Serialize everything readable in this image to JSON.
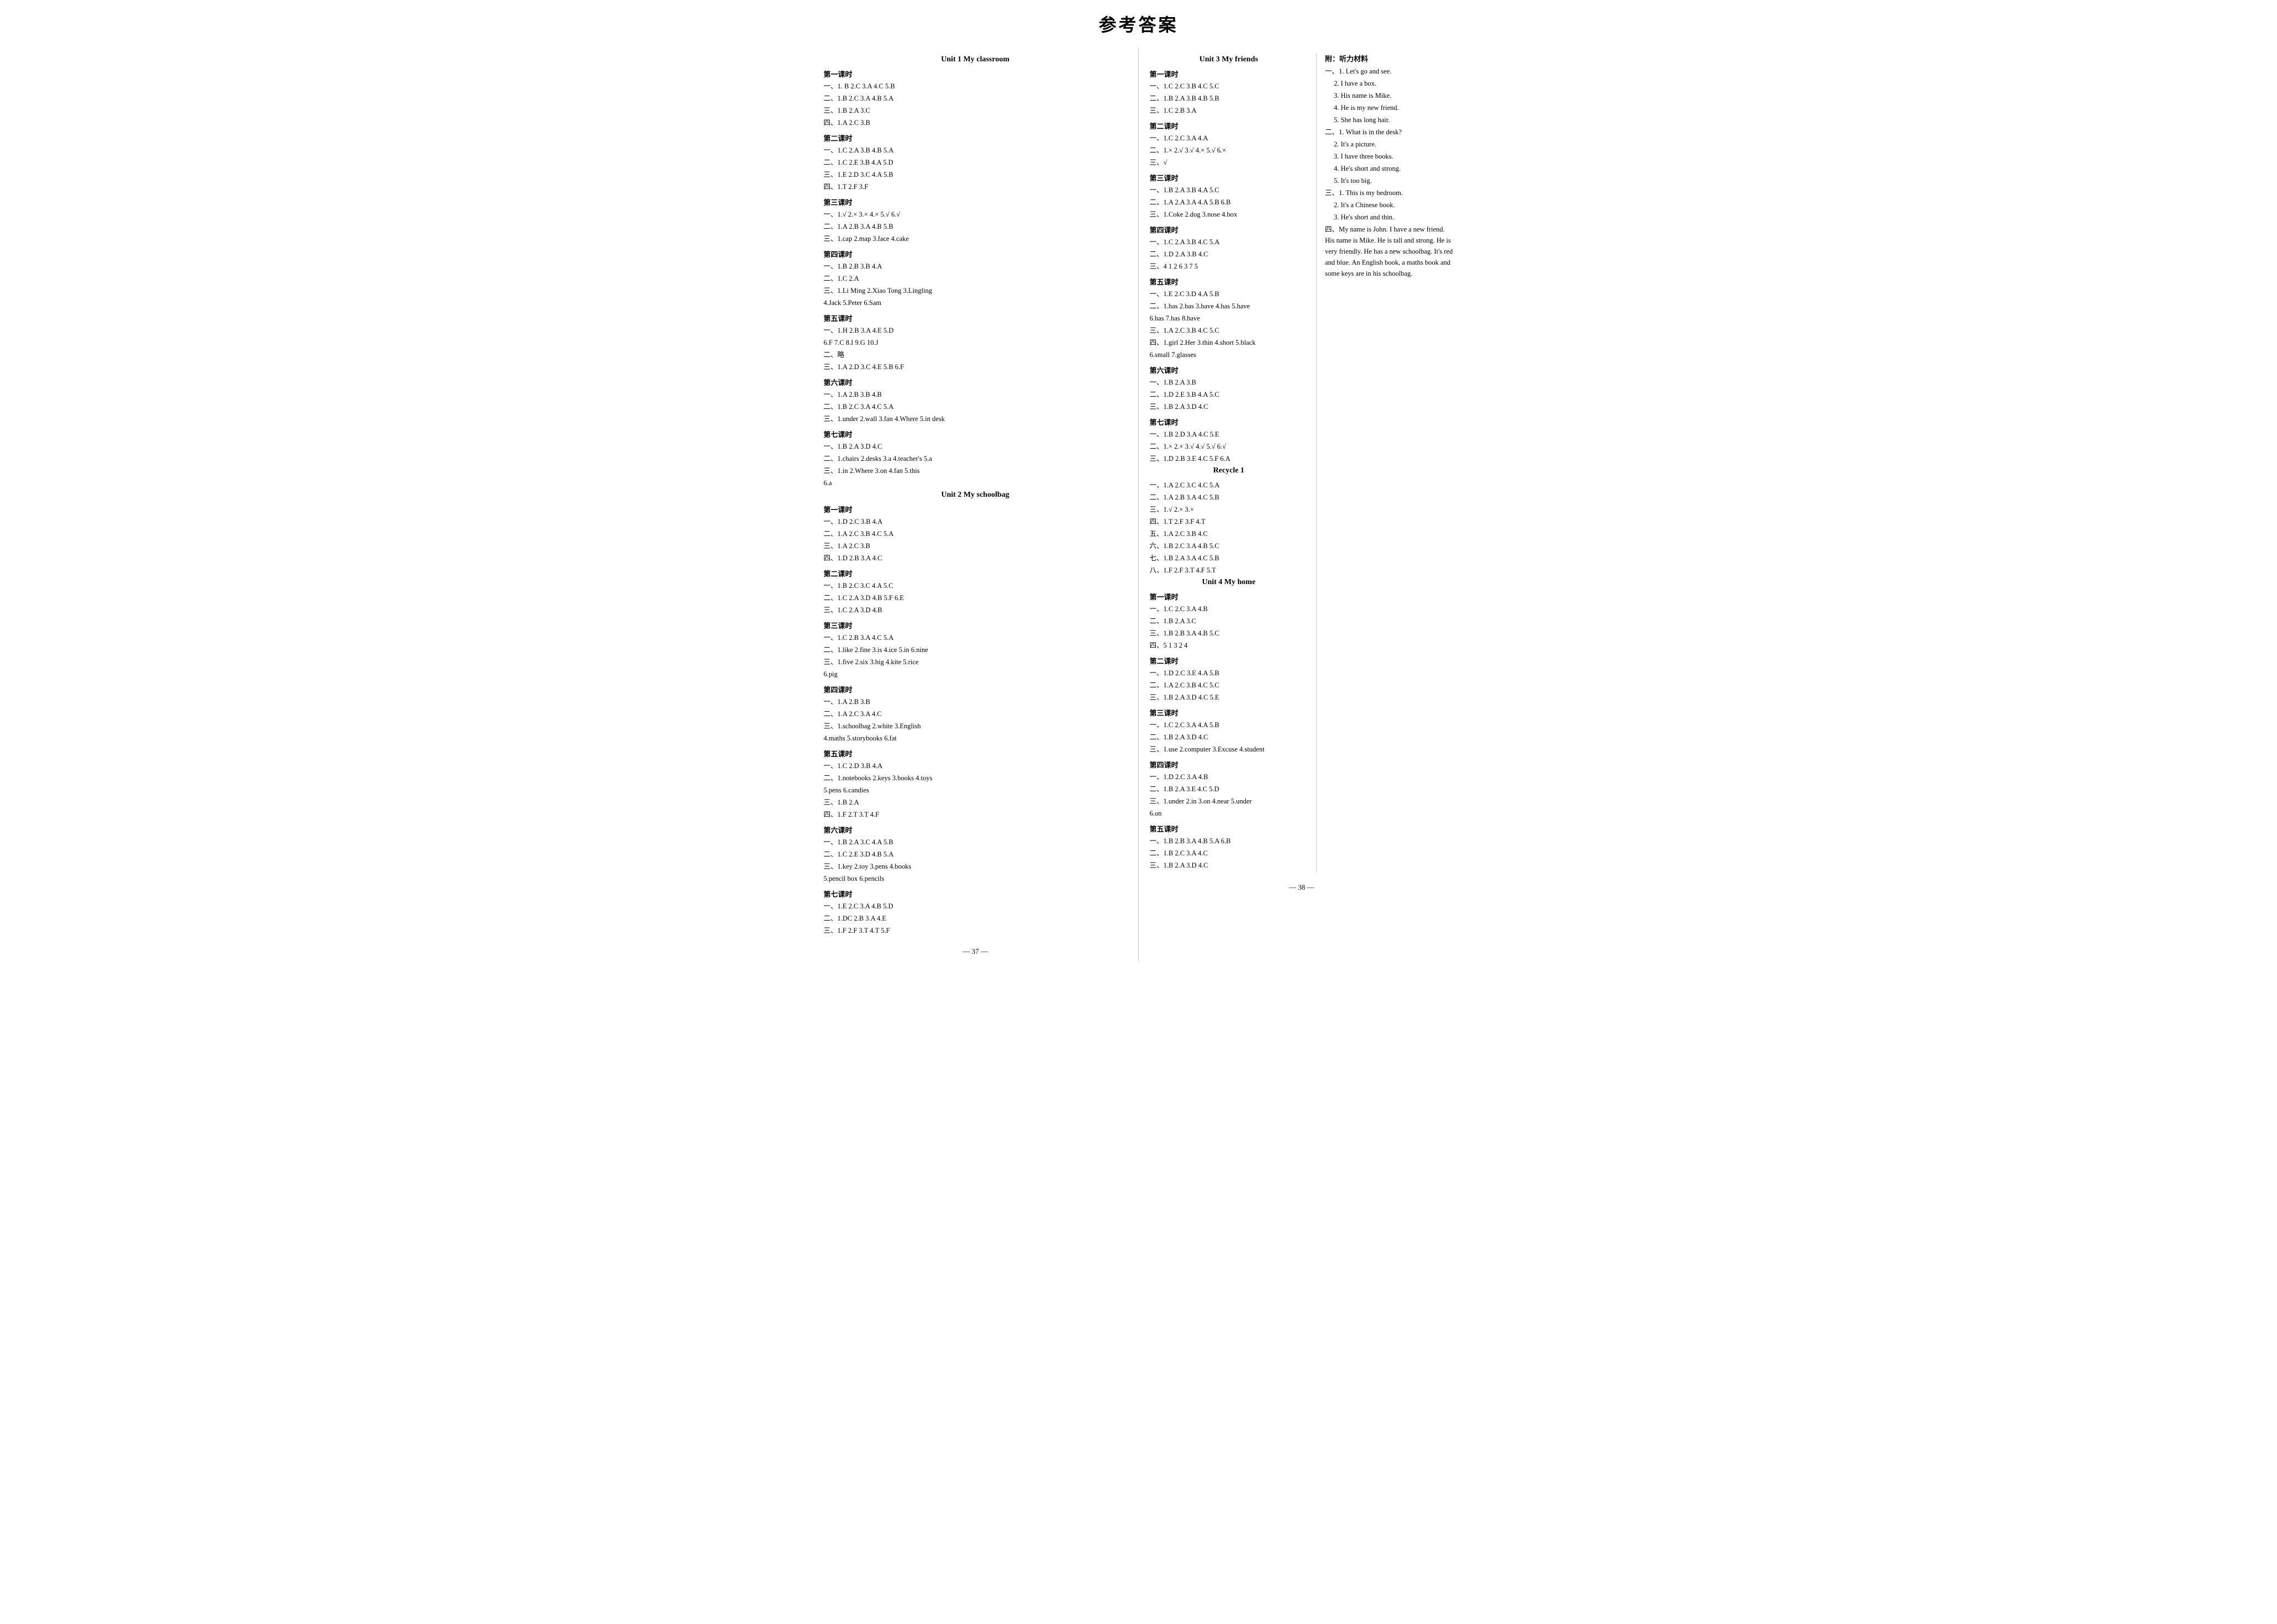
{
  "page_title": "参考答案",
  "left_page": {
    "unit1": {
      "title": "Unit 1   My classroom",
      "lessons": [
        {
          "name": "第一课时",
          "lines": [
            "一、1. B  2.C  3.A  4.C  5.B",
            "二、1.B  2.C  3.A  4.B  5.A",
            "三、1.B  2.A  3.C",
            "四、1.A  2.C  3.B"
          ]
        },
        {
          "name": "第二课时",
          "lines": [
            "一、1.C  2.A  3.B  4.B  5.A",
            "二、1.C  2.E  3.B  4.A  5.D",
            "三、1.E  2.D  3.C  4.A  5.B",
            "四、1.T  2.F  3.F"
          ]
        },
        {
          "name": "第三课时",
          "lines": [
            "一、1.√  2.×  3.×  4.×  5.√  6.√",
            "二、1.A  2.B  3.A  4.B  5.B",
            "三、1.cap  2.map  3.face  4.cake"
          ]
        },
        {
          "name": "第四课时",
          "lines": [
            "一、1.B  2.B  3.B  4.A",
            "二、1.C  2.A",
            "三、1.Li Ming  2.Xiao Tong  3.Lingling",
            "    4.Jack  5.Peter  6.Sam"
          ]
        },
        {
          "name": "第五课时",
          "lines": [
            "一、1.H  2.B  3.A  4.E  5.D",
            "    6.F  7.C  8.I  9.G  10.J",
            "二、略",
            "三、1.A  2.D  3.C  4.E  5.B  6.F"
          ]
        },
        {
          "name": "第六课时",
          "lines": [
            "一、1.A  2.B  3.B  4.B",
            "二、1.B  2.C  3.A  4.C  5.A",
            "三、1.under  2.wall  3.fan  4.Where  5.in  desk"
          ]
        },
        {
          "name": "第七课时",
          "lines": [
            "一、1.B  2.A  3.D  4.C",
            "二、1.chairs  2.desks  3.a  4.teacher's  5.a",
            "三、1.in  2.Where  3.on  4.fan  5.this",
            "    6.a"
          ]
        }
      ]
    },
    "unit2": {
      "title": "Unit 2   My schoolbag",
      "lessons": [
        {
          "name": "第一课时",
          "lines": [
            "一、1.D  2.C  3.B  4.A",
            "二、1.A  2.C  3.B  4.C  5.A",
            "三、1.A  2.C  3.B",
            "四、1.D  2.B  3.A  4.C"
          ]
        },
        {
          "name": "第二课时",
          "lines": [
            "一、1.B  2.C  3.C  4.A  5.C",
            "二、1.C  2.A  3.D  4.B  5.F  6.E",
            "三、1.C  2.A  3.D  4.B"
          ]
        },
        {
          "name": "第三课时",
          "lines": [
            "一、1.C  2.B  3.A  4.C  5.A",
            "二、1.like  2.fine  3.is  4.ice  5.in  6.nine",
            "三、1.five  2.six  3.big  4.kite  5.rice",
            "    6.pig"
          ]
        },
        {
          "name": "第四课时",
          "lines": [
            "一、1.A  2.B  3.B",
            "二、1.A  2.C  3.A  4.C",
            "三、1.schoolbag  2.white  3.English",
            "    4.maths  5.storybooks  6.fat"
          ]
        },
        {
          "name": "第五课时",
          "lines": [
            "一、1.C  2.D  3.B  4.A",
            "二、1.notebooks  2.keys  3.books  4.toys",
            "    5.pens  6.candies",
            "三、1.B  2.A",
            "四、1.F  2.T  3.T  4.F"
          ]
        },
        {
          "name": "第六课时",
          "lines": [
            "一、1.B  2.A  3.C  4.A  5.B",
            "二、1.C  2.E  3.D  4.B  5.A",
            "三、1.key  2.toy  3.pens  4.books",
            "    5.pencil box  6.pencils"
          ]
        },
        {
          "name": "第七课时",
          "lines": [
            "一、1.E  2.C  3.A  4.B  5.D",
            "二、1.DC  2.B  3.A  4.E",
            "三、1.F  2.F  3.T  4.T  5.F"
          ]
        }
      ]
    }
  },
  "right_page": {
    "unit3": {
      "title": "Unit 3   My friends",
      "lessons": [
        {
          "name": "第一课时",
          "lines": [
            "一、1.C  2.C  3.B  4.C  5.C",
            "二、1.B  2.A  3.B  4.B  5.B",
            "三、1.C  2.B  3.A"
          ]
        },
        {
          "name": "第二课时",
          "lines": [
            "一、1.C  2.C  3.A  4.A",
            "二、1.×  2.√  3.√  4.×  5.√  6.×",
            "三、√"
          ]
        },
        {
          "name": "第三课时",
          "lines": [
            "一、1.B  2.A  3.B  4.A  5.C",
            "二、1.A  2.A  3.A  4.A  5.B  6.B",
            "三、1.Coke  2.dog  3.nose  4.box"
          ]
        },
        {
          "name": "第四课时",
          "lines": [
            "一、1.C  2.A  3.B  4.C  5.A",
            "二、1.D  2.A  3.B  4.C",
            "三、4 1 2 6 3 7 5"
          ]
        },
        {
          "name": "第五课时",
          "lines": [
            "一、1.E  2.C  3.D  4.A  5.B",
            "二、1.has  2.has  3.have  4.has  5.have",
            "    6.has  7.has  8.have",
            "三、1.A  2.C  3.B  4.C  5.C",
            "四、1.girl  2.Her  3.thin  4.short  5.black",
            "    6.small  7.glasses"
          ]
        },
        {
          "name": "第六课时",
          "lines": [
            "一、1.B  2.A  3.B",
            "二、1.D  2.E  3.B  4.A  5.C",
            "三、1.B  2.A  3.D  4.C"
          ]
        },
        {
          "name": "第七课时",
          "lines": [
            "一、1.B  2.D  3.A  4.C  5.E",
            "二、1.×  2.×  3.√  4.√  5.√  6.√",
            "三、1.D  2.B  3.E  4.C  5.F  6.A"
          ]
        }
      ]
    },
    "recycle1": {
      "title": "Recycle 1",
      "lines": [
        "一、1.A  2.C  3.C  4.C  5.A",
        "二、1.A  2.B  3.A  4.C  5.B",
        "三、1.√  2.×  3.×",
        "四、1.T  2.F  3.F  4.T",
        "五、1.A  2.C  3.B  4.C",
        "六、1.B  2.C  3.A  4.B  5.C",
        "七、1.B  2.A  3.A  4.C  5.B",
        "八、1.F  2.F  3.T  4.F  5.T"
      ]
    },
    "unit4": {
      "title": "Unit 4   My home",
      "lessons": [
        {
          "name": "第一课时",
          "lines": [
            "一、1.C  2.C  3.A  4.B",
            "二、1.B  2.A  3.C",
            "三、1.B  2.B  3.A  4.B  5.C",
            "四、5 1 3 2 4"
          ]
        },
        {
          "name": "第二课时",
          "lines": [
            "一、1.D  2.C  3.E  4.A  5.B",
            "二、1.A  2.C  3.B  4.C  5.C",
            "三、1.B  2.A  3.D  4.C  5.E"
          ]
        },
        {
          "name": "第三课时",
          "lines": [
            "一、1.C  2.C  3.A  4.A  5.B",
            "二、1.B  2.A  3.D  4.C",
            "三、1.use  2.computer  3.Excuse  4.student"
          ]
        },
        {
          "name": "第四课时",
          "lines": [
            "一、1.D  2.C  3.A  4.B",
            "二、1.B  2.A  3.E  4.C  5.D",
            "三、1.under  2.in  3.on  4.near  5.under",
            "    6.on"
          ]
        },
        {
          "name": "第五课时",
          "lines": [
            "一、1.B  2.B  3.A  4.B  5.A  6.B",
            "二、1.B  2.C  3.A  4.C",
            "三、1.B  2.A  3.D  4.C"
          ]
        }
      ]
    }
  },
  "appendix": {
    "title": "附：听力材料",
    "sections": [
      {
        "label": "一、",
        "items": [
          "1. Let's go and see.",
          "2. I have a box.",
          "3. His name is Mike.",
          "4. He is my new friend.",
          "5. She has long hair."
        ]
      },
      {
        "label": "二、",
        "items": [
          "1. What is in the desk?",
          "2. It's a picture.",
          "3. I have three books.",
          "4. He's short and strong.",
          "5. It's too big."
        ]
      },
      {
        "label": "三、",
        "items": [
          "1. This is my bedroom.",
          "2. It's a Chinese book.",
          "3. He's short and thin."
        ]
      },
      {
        "label": "四、",
        "items": [
          "My name is John. I have a new friend. His name is Mike. He is tall and strong. He is very friendly. He has a new schoolbag. It's red and blue. An English book, a maths book and some keys are in his schoolbag."
        ]
      }
    ]
  },
  "page_numbers": {
    "left": "— 37 —",
    "right": "— 38 —"
  }
}
